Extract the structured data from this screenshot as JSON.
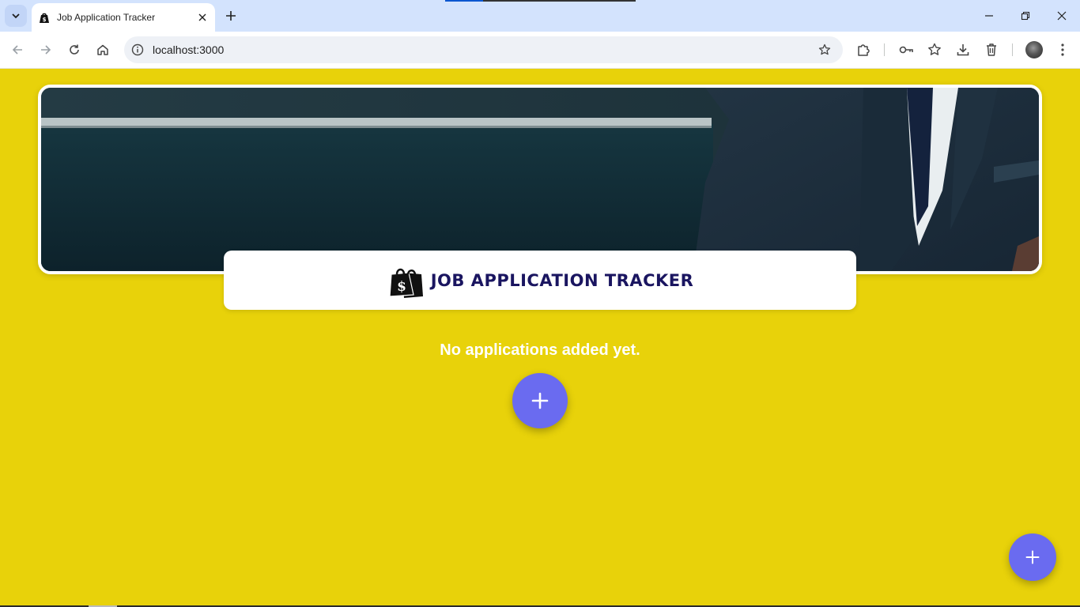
{
  "browser": {
    "tab_title": "Job Application Tracker",
    "url": "localhost:3000"
  },
  "app": {
    "title": "JOB APPLICATION TRACKER",
    "empty_message": "No applications added yet.",
    "accent_color": "#6a6bf0",
    "background_color": "#e8d20a",
    "title_color": "#1a1560"
  },
  "icons": {
    "logo": "money-bag-icon",
    "add": "plus-icon"
  }
}
